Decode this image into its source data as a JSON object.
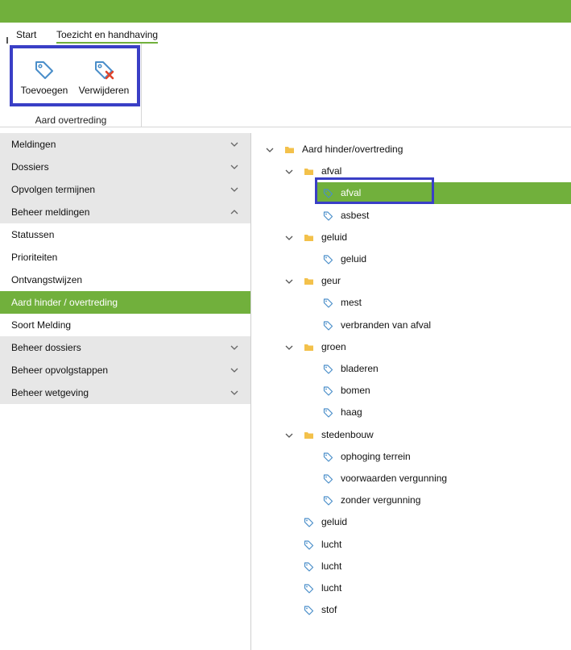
{
  "colors": {
    "accent": "#71b03c",
    "highlight": "#3a3fc6",
    "section_bg": "#e7e7e7",
    "tag_icon": "#4a8ec9",
    "folder_icon": "#f3c14b",
    "delete_icon": "#e0442b"
  },
  "ribbon": {
    "tabs": [
      "Start",
      "Toezicht en handhaving"
    ],
    "buttons": {
      "add": "Toevoegen",
      "remove": "Verwijderen"
    },
    "group_label": "Aard overtreding"
  },
  "sidebar": {
    "items": [
      {
        "label": "Meldingen",
        "kind": "section",
        "chevron": "down"
      },
      {
        "label": "Dossiers",
        "kind": "section",
        "chevron": "down"
      },
      {
        "label": "Opvolgen termijnen",
        "kind": "section",
        "chevron": "down"
      },
      {
        "label": "Beheer meldingen",
        "kind": "section",
        "chevron": "up"
      },
      {
        "label": "Statussen",
        "kind": "sub"
      },
      {
        "label": "Prioriteiten",
        "kind": "sub"
      },
      {
        "label": "Ontvangstwijzen",
        "kind": "sub"
      },
      {
        "label": "Aard hinder / overtreding",
        "kind": "sub",
        "selected": true
      },
      {
        "label": "Soort Melding",
        "kind": "sub"
      },
      {
        "label": "Beheer dossiers",
        "kind": "section",
        "chevron": "down"
      },
      {
        "label": "Beheer opvolgstappen",
        "kind": "section",
        "chevron": "down"
      },
      {
        "label": "Beheer wetgeving",
        "kind": "section",
        "chevron": "down"
      }
    ]
  },
  "tree": {
    "nodes": [
      {
        "label": "Aard hinder/overtreding",
        "level": 0,
        "type": "folder",
        "expanded": true
      },
      {
        "label": "afval",
        "level": 1,
        "type": "folder",
        "expanded": true
      },
      {
        "label": "afval",
        "level": 2,
        "type": "tag",
        "selected": true
      },
      {
        "label": "asbest",
        "level": 2,
        "type": "tag"
      },
      {
        "label": "geluid",
        "level": 1,
        "type": "folder",
        "expanded": true
      },
      {
        "label": "geluid",
        "level": 2,
        "type": "tag"
      },
      {
        "label": "geur",
        "level": 1,
        "type": "folder",
        "expanded": true
      },
      {
        "label": "mest",
        "level": 2,
        "type": "tag"
      },
      {
        "label": "verbranden van afval",
        "level": 2,
        "type": "tag"
      },
      {
        "label": "groen",
        "level": 1,
        "type": "folder",
        "expanded": true
      },
      {
        "label": "bladeren",
        "level": 2,
        "type": "tag"
      },
      {
        "label": "bomen",
        "level": 2,
        "type": "tag"
      },
      {
        "label": "haag",
        "level": 2,
        "type": "tag"
      },
      {
        "label": "stedenbouw",
        "level": 1,
        "type": "folder",
        "expanded": true
      },
      {
        "label": "ophoging terrein",
        "level": 2,
        "type": "tag"
      },
      {
        "label": "voorwaarden vergunning",
        "level": 2,
        "type": "tag"
      },
      {
        "label": "zonder vergunning",
        "level": 2,
        "type": "tag"
      },
      {
        "label": "geluid",
        "level": 1,
        "type": "tag"
      },
      {
        "label": "lucht",
        "level": 1,
        "type": "tag"
      },
      {
        "label": "lucht",
        "level": 1,
        "type": "tag"
      },
      {
        "label": "lucht",
        "level": 1,
        "type": "tag"
      },
      {
        "label": "stof",
        "level": 1,
        "type": "tag"
      }
    ]
  }
}
